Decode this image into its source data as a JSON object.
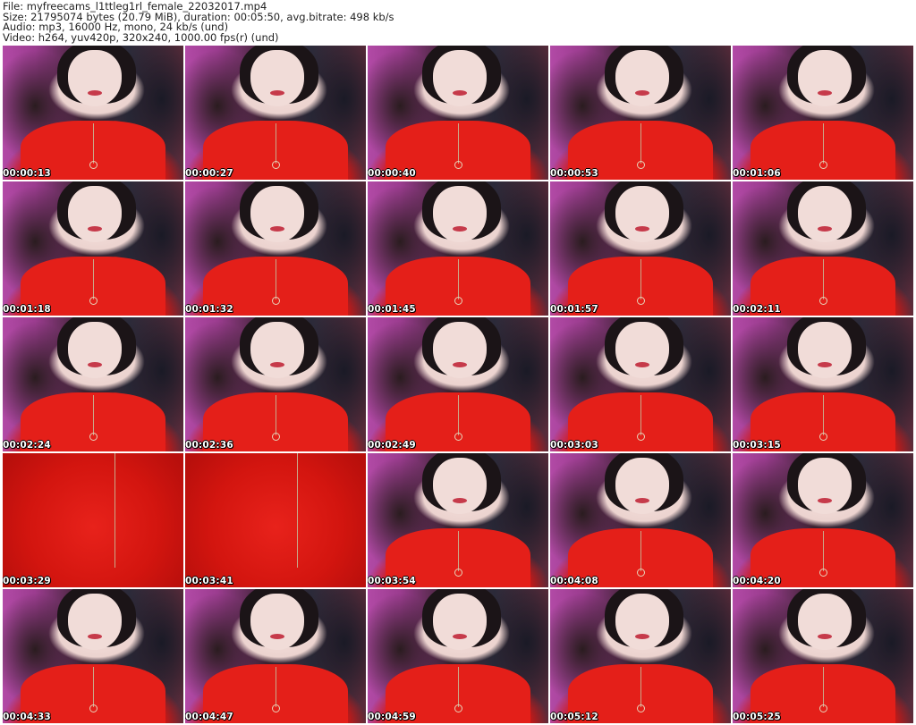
{
  "header": {
    "line1": "File: myfreecams_l1ttleg1rl_female_22032017.mp4",
    "line2": "Size: 21795074 bytes (20.79 MiB), duration: 00:05:50, avg.bitrate: 498 kb/s",
    "line3": "Audio: mp3, 16000 Hz, mono, 24 kb/s (und)",
    "line4": "Video: h264, yuv420p, 320x240, 1000.00 fps(r) (und)"
  },
  "thumbnails": [
    {
      "time": "00:00:13",
      "kind": "portrait"
    },
    {
      "time": "00:00:27",
      "kind": "portrait"
    },
    {
      "time": "00:00:40",
      "kind": "portrait"
    },
    {
      "time": "00:00:53",
      "kind": "portrait"
    },
    {
      "time": "00:01:06",
      "kind": "portrait"
    },
    {
      "time": "00:01:18",
      "kind": "portrait"
    },
    {
      "time": "00:01:32",
      "kind": "portrait"
    },
    {
      "time": "00:01:45",
      "kind": "portrait"
    },
    {
      "time": "00:01:57",
      "kind": "portrait"
    },
    {
      "time": "00:02:11",
      "kind": "portrait"
    },
    {
      "time": "00:02:24",
      "kind": "portrait"
    },
    {
      "time": "00:02:36",
      "kind": "portrait"
    },
    {
      "time": "00:02:49",
      "kind": "portrait"
    },
    {
      "time": "00:03:03",
      "kind": "portrait"
    },
    {
      "time": "00:03:15",
      "kind": "portrait"
    },
    {
      "time": "00:03:29",
      "kind": "closeup"
    },
    {
      "time": "00:03:41",
      "kind": "closeup"
    },
    {
      "time": "00:03:54",
      "kind": "portrait"
    },
    {
      "time": "00:04:08",
      "kind": "portrait"
    },
    {
      "time": "00:04:20",
      "kind": "portrait"
    },
    {
      "time": "00:04:33",
      "kind": "portrait"
    },
    {
      "time": "00:04:47",
      "kind": "portrait"
    },
    {
      "time": "00:04:59",
      "kind": "portrait"
    },
    {
      "time": "00:05:12",
      "kind": "portrait"
    },
    {
      "time": "00:05:25",
      "kind": "portrait"
    }
  ]
}
